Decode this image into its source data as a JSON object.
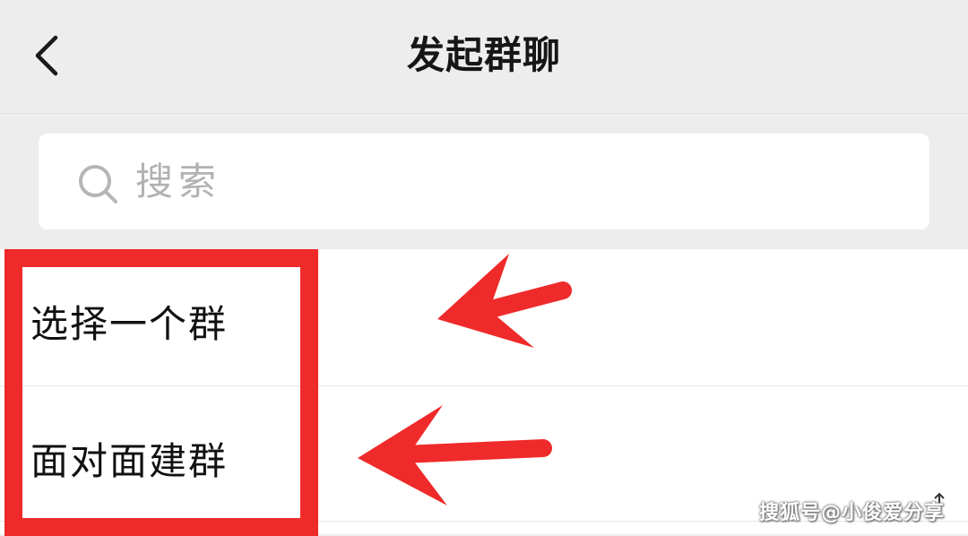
{
  "header": {
    "title": "发起群聊",
    "back_icon": "chevron-left-icon"
  },
  "search": {
    "placeholder": "搜索",
    "icon": "search-icon"
  },
  "list": {
    "items": [
      {
        "label": "选择一个群"
      },
      {
        "label": "面对面建群"
      }
    ]
  },
  "annotations": {
    "highlight_color": "#ef2a2a"
  },
  "watermark": {
    "text": "搜狐号@小俊爱分享"
  }
}
